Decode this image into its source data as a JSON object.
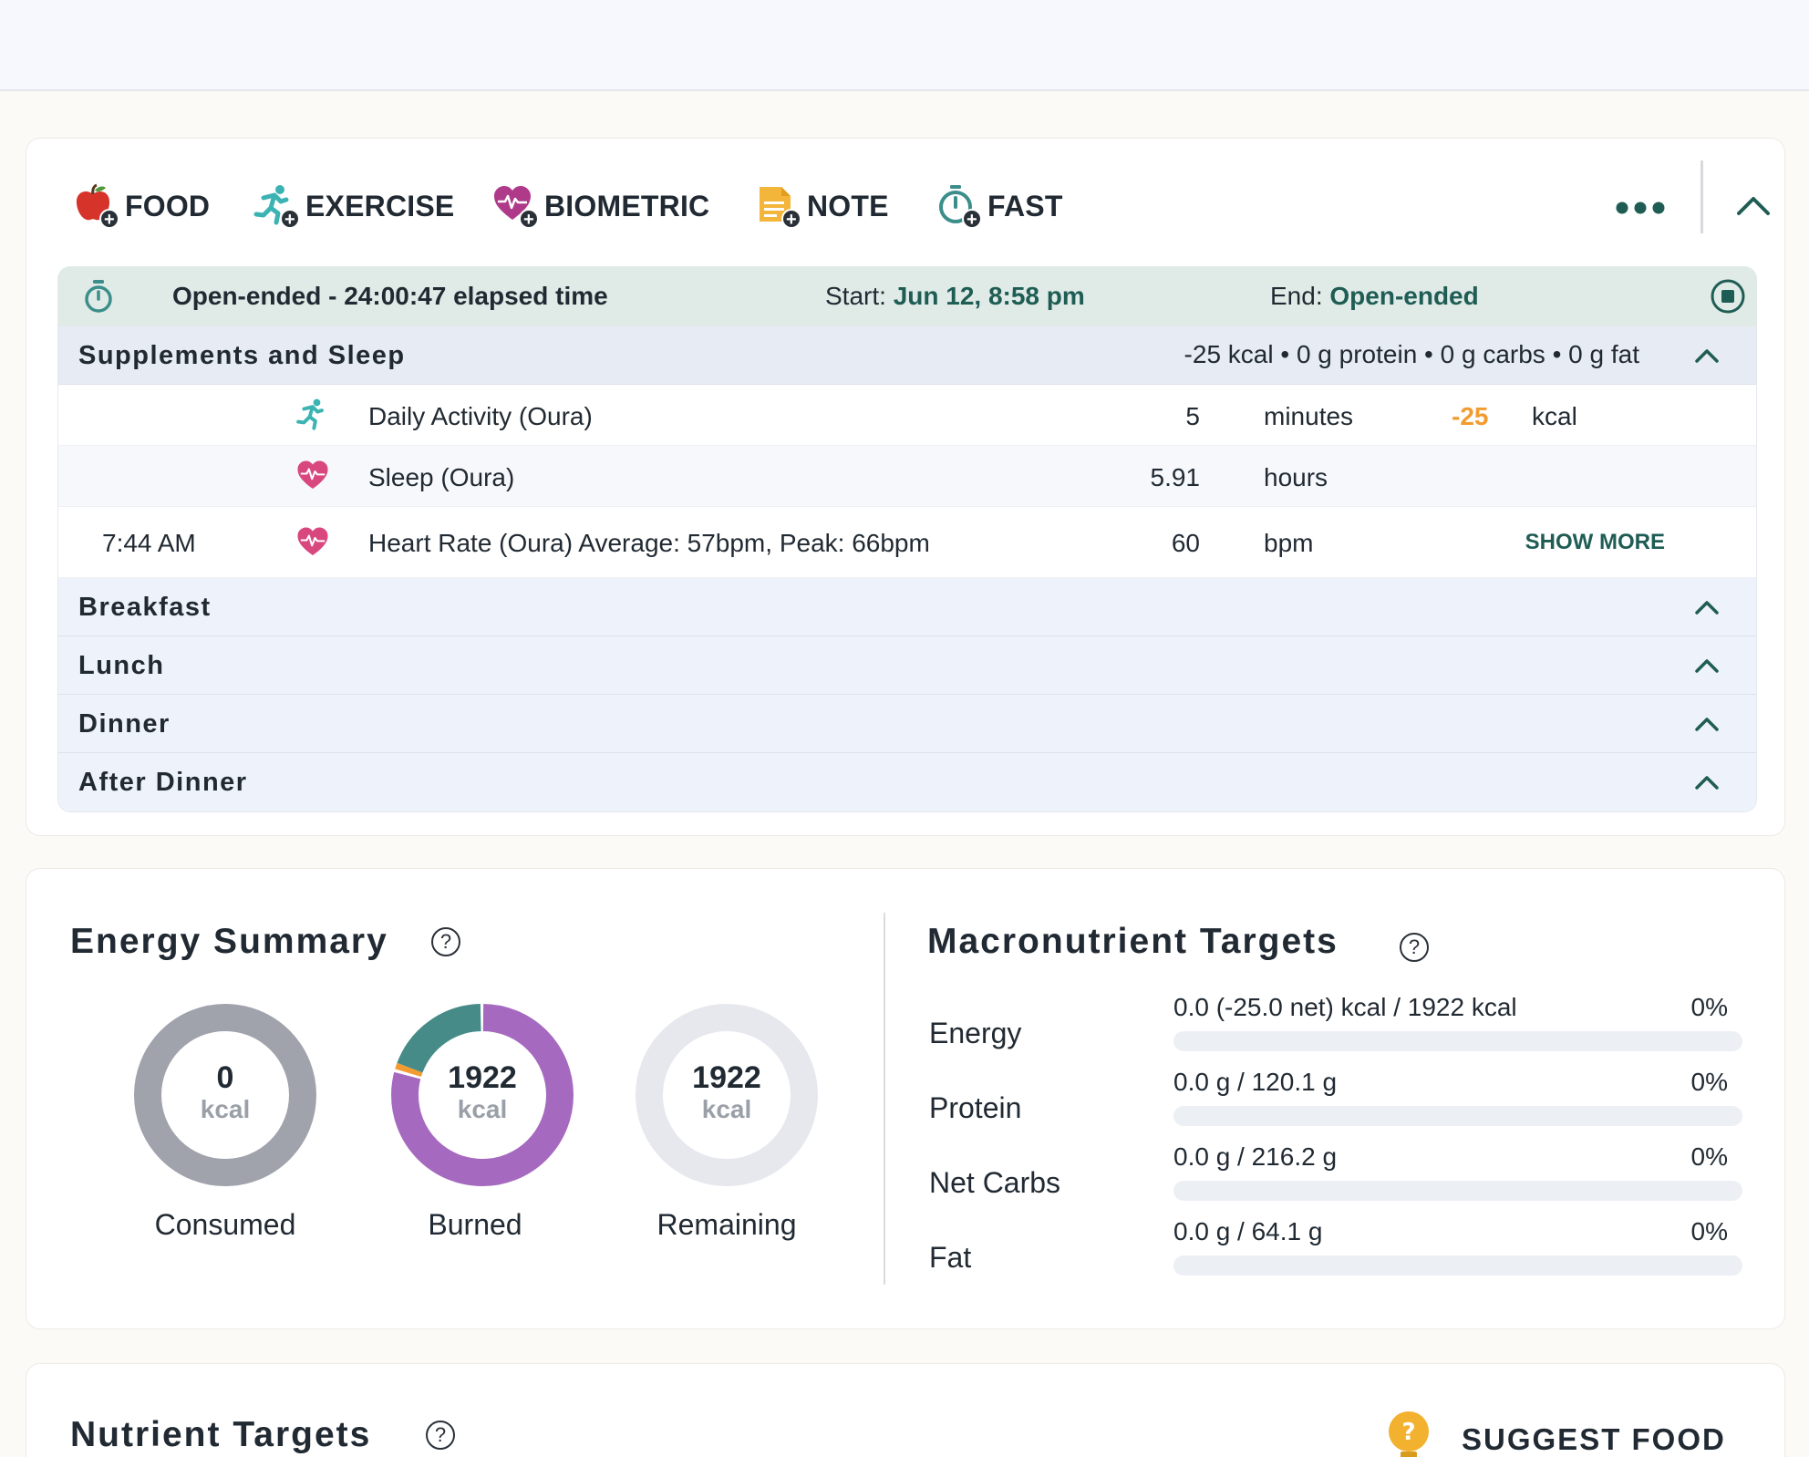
{
  "toolbar": {
    "buttons": [
      {
        "label": "FOOD",
        "icon": "apple-icon"
      },
      {
        "label": "EXERCISE",
        "icon": "running-icon"
      },
      {
        "label": "BIOMETRIC",
        "icon": "heart-pulse-icon"
      },
      {
        "label": "NOTE",
        "icon": "note-icon"
      },
      {
        "label": "FAST",
        "icon": "stopwatch-icon"
      }
    ],
    "more_icon": "ellipsis-icon",
    "collapse_icon": "chevron-up-icon"
  },
  "fast": {
    "elapsed": "Open-ended - 24:00:47 elapsed time",
    "start_label": "Start: ",
    "start_value": "Jun 12, 8:58 pm",
    "end_label": "End: ",
    "end_value": "Open-ended"
  },
  "groups": [
    {
      "name": "Supplements and Sleep",
      "summary": "-25 kcal • 0 g protein • 0 g carbs • 0 g fat",
      "entries": [
        {
          "time": "",
          "icon": "running-icon",
          "name": "Daily Activity (Oura)",
          "qty": "5",
          "unit": "minutes",
          "kcal": "-25",
          "kcal_unit": "kcal"
        },
        {
          "time": "",
          "icon": "heart-pulse-icon",
          "name": "Sleep (Oura)",
          "qty": "5.91",
          "unit": "hours"
        },
        {
          "time": "7:44 AM",
          "icon": "heart-pulse-icon",
          "name": "Heart Rate (Oura)  Average: 57bpm, Peak: 66bpm",
          "qty": "60",
          "unit": "bpm",
          "action": "SHOW MORE"
        }
      ]
    },
    {
      "name": "Breakfast"
    },
    {
      "name": "Lunch"
    },
    {
      "name": "Dinner"
    },
    {
      "name": "After Dinner"
    }
  ],
  "energy_summary": {
    "title": "Energy Summary",
    "rings": [
      {
        "label": "Consumed",
        "value": "0",
        "unit": "kcal"
      },
      {
        "label": "Burned",
        "value": "1922",
        "unit": "kcal"
      },
      {
        "label": "Remaining",
        "value": "1922",
        "unit": "kcal"
      }
    ],
    "colors": {
      "consumed": "#a0a3ac",
      "burned": "#a56abf",
      "burned_teal": "#468b88",
      "burned_orange": "#f39b30",
      "remaining": "#e6e8ee"
    }
  },
  "macro_targets": {
    "title": "Macronutrient Targets",
    "rows": [
      {
        "name": "Energy",
        "text": "0.0 (-25.0 net) kcal / 1922 kcal",
        "pct": "0%",
        "progress": 0
      },
      {
        "name": "Protein",
        "text": "0.0 g / 120.1 g",
        "pct": "0%",
        "progress": 0
      },
      {
        "name": "Net Carbs",
        "text": "0.0 g / 216.2 g",
        "pct": "0%",
        "progress": 0
      },
      {
        "name": "Fat",
        "text": "0.0 g / 64.1 g",
        "pct": "0%",
        "progress": 0
      }
    ]
  },
  "nutrient_targets": {
    "title": "Nutrient Targets",
    "suggest_label": "SUGGEST FOOD",
    "suggest_icon": "lightbulb-icon"
  },
  "help_icon": "help-icon"
}
